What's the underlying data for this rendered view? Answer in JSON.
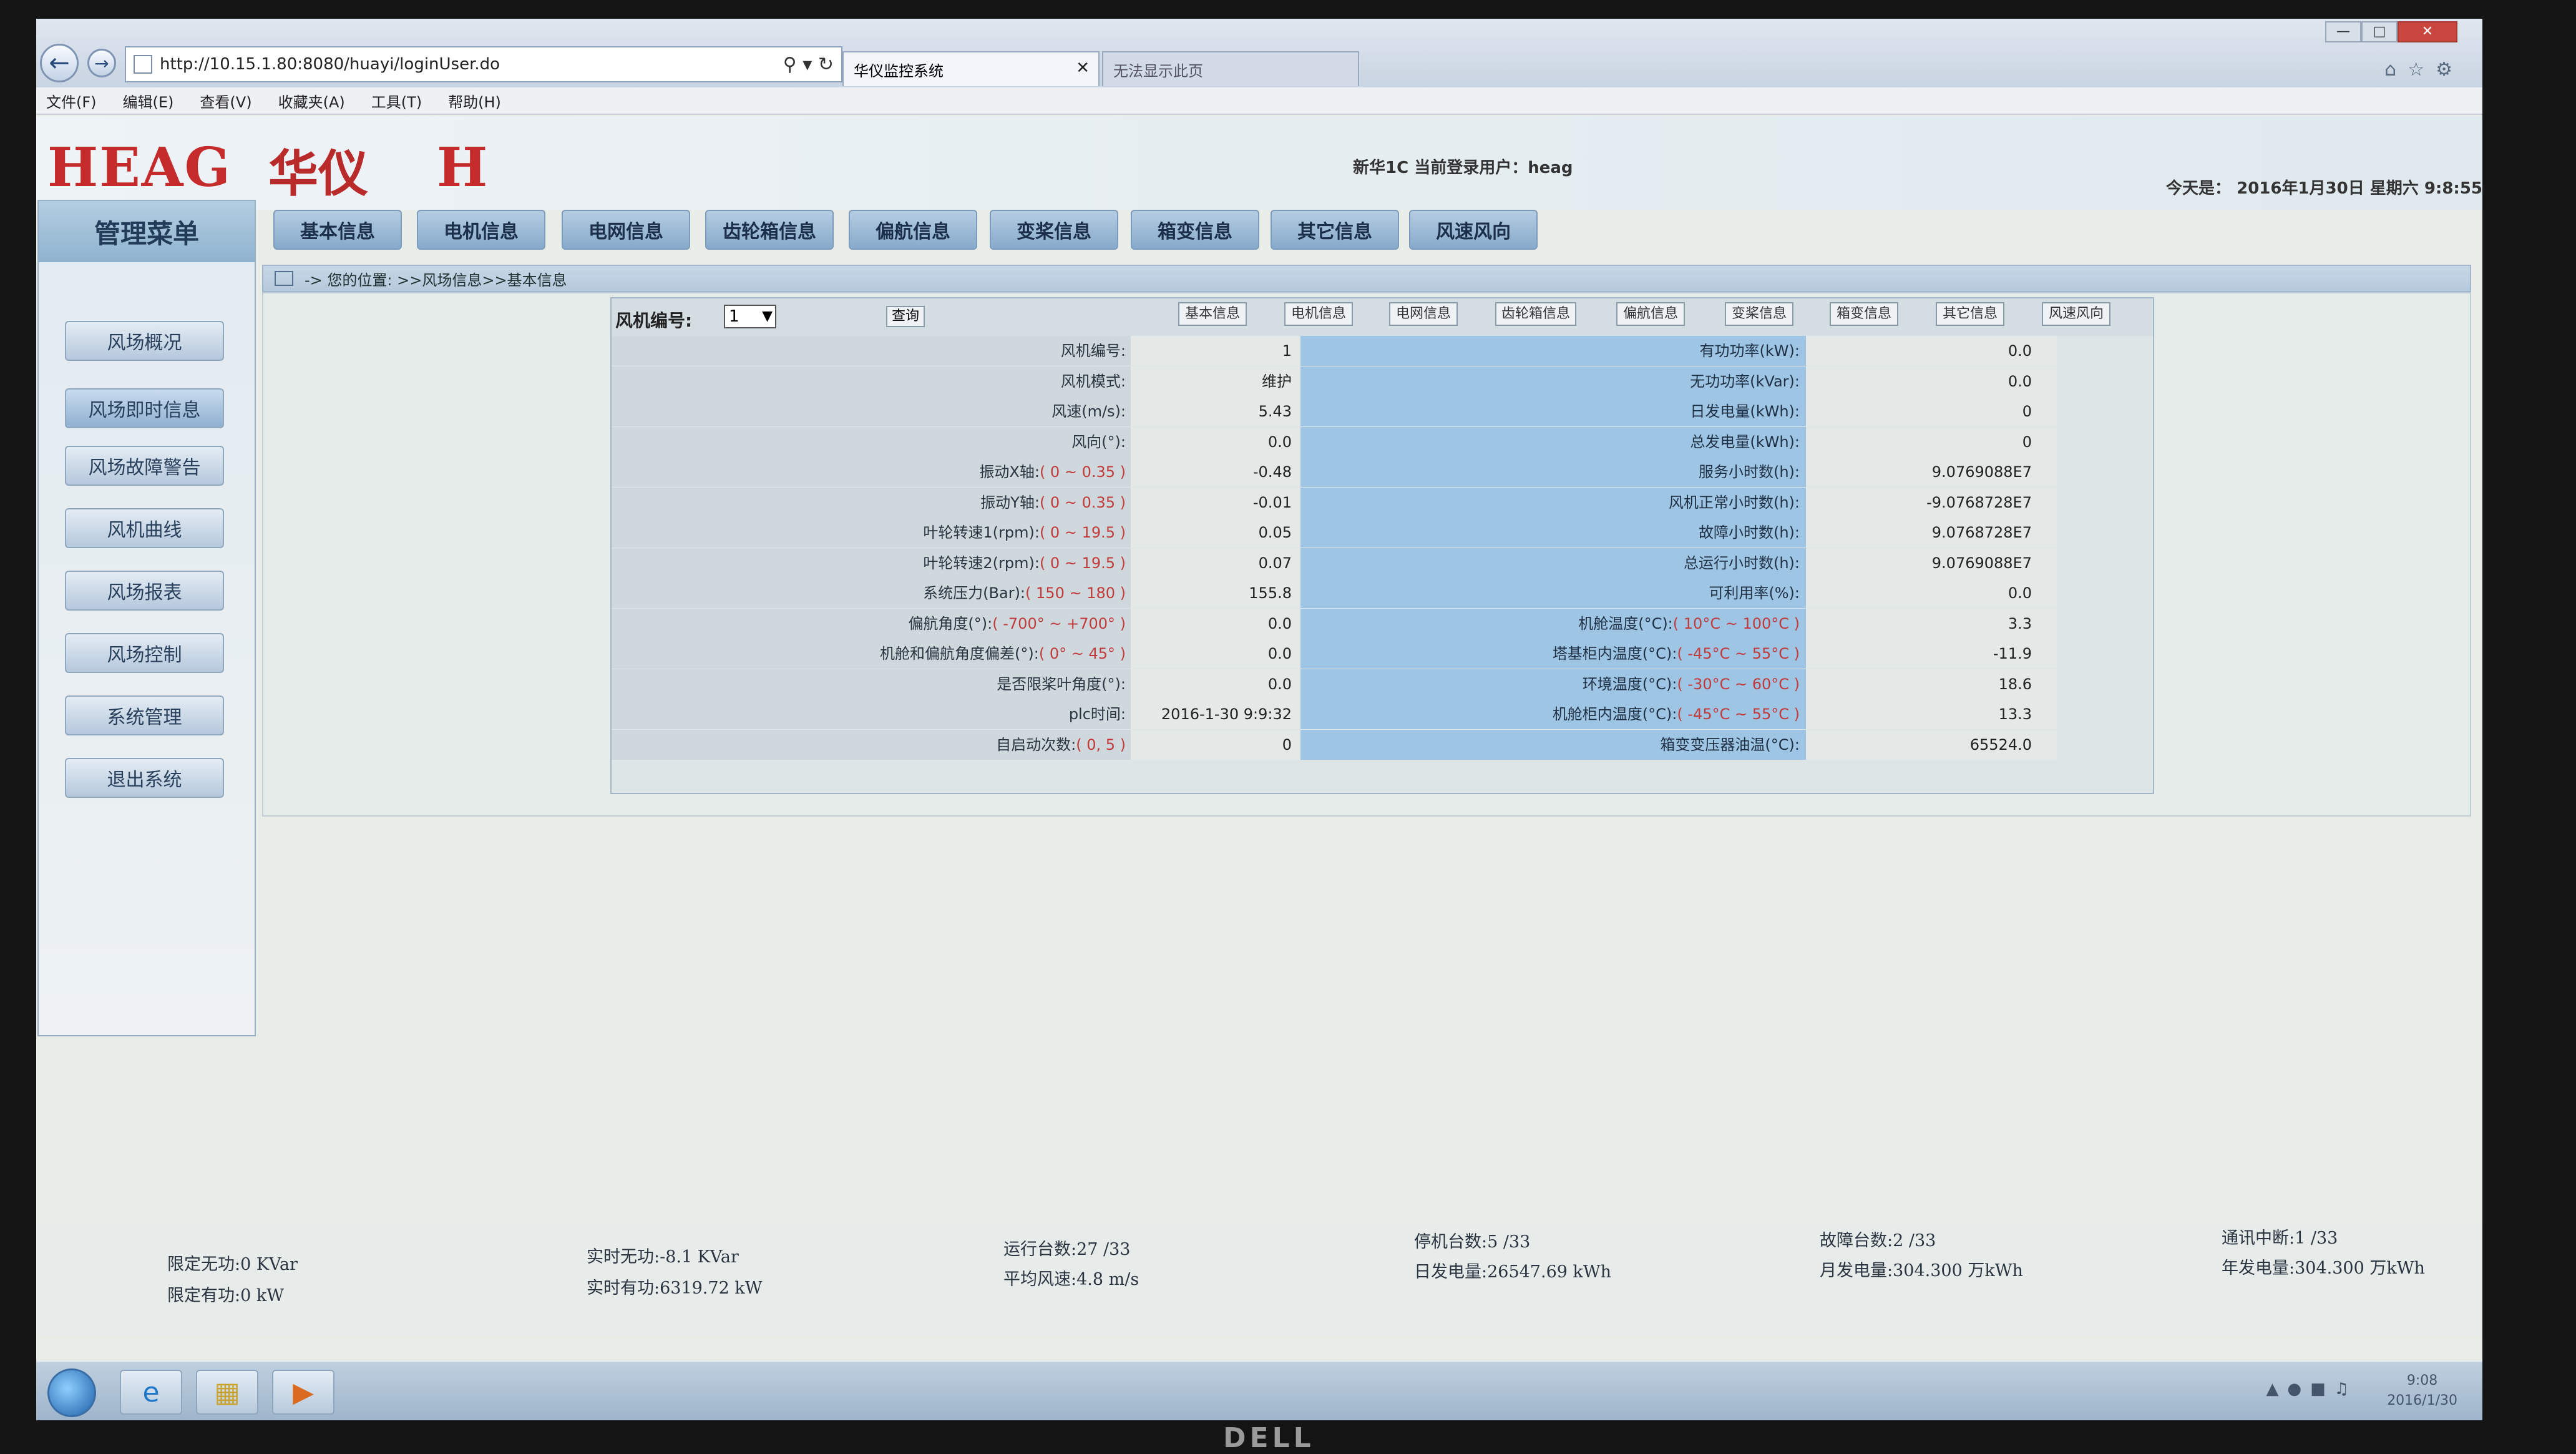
{
  "browser": {
    "url": "http://10.15.1.80:8080/huayi/loginUser.do",
    "tab_active": "华仪监控系统",
    "tab_inactive": "无法显示此页",
    "menu": [
      "文件(F)",
      "编辑(E)",
      "查看(V)",
      "收藏夹(A)",
      "工具(T)",
      "帮助(H)"
    ]
  },
  "header": {
    "logo_left": "HEAG",
    "logo_cn": "华仪",
    "logo_right": "H",
    "user_info": "新华1C  当前登录用户：heag",
    "today": "今天是： 2016年1月30日  星期六  9:8:55"
  },
  "sidebar": {
    "title": "管理菜单",
    "items": [
      "风场概况",
      "风场即时信息",
      "风场故障警告",
      "风机曲线",
      "风场报表",
      "风场控制",
      "系统管理",
      "退出系统"
    ]
  },
  "top_tabs": [
    "基本信息",
    "电机信息",
    "电网信息",
    "齿轮箱信息",
    "偏航信息",
    "变桨信息",
    "箱变信息",
    "其它信息",
    "风速风向"
  ],
  "breadcrumb": "-> 您的位置: >>风场信息>>基本信息",
  "panel": {
    "fan_no_label": "风机编号:",
    "fan_no_value": "1",
    "query_label": "查询",
    "sub_tabs": [
      "基本信息",
      "电机信息",
      "电网信息",
      "齿轮箱信息",
      "偏航信息",
      "变桨信息",
      "箱变信息",
      "其它信息",
      "风速风向"
    ],
    "left_rows": [
      {
        "label": "风机编号:",
        "range": "",
        "value": "1"
      },
      {
        "label": "风机模式:",
        "range": "",
        "value": "维护"
      },
      {
        "label": "风速(m/s):",
        "range": "",
        "value": "5.43"
      },
      {
        "label": "风向(°):",
        "range": "",
        "value": "0.0"
      },
      {
        "label": "振动X轴:",
        "range": "( 0 ~ 0.35 )",
        "value": "-0.48"
      },
      {
        "label": "振动Y轴:",
        "range": "( 0 ~ 0.35 )",
        "value": "-0.01"
      },
      {
        "label": "叶轮转速1(rpm):",
        "range": "( 0 ~ 19.5 )",
        "value": "0.05"
      },
      {
        "label": "叶轮转速2(rpm):",
        "range": "( 0 ~ 19.5 )",
        "value": "0.07"
      },
      {
        "label": "系统压力(Bar):",
        "range": "( 150 ~ 180 )",
        "value": "155.8"
      },
      {
        "label": "偏航角度(°):",
        "range": "( -700° ~ +700° )",
        "value": "0.0"
      },
      {
        "label": "机舱和偏航角度偏差(°):",
        "range": "( 0° ~ 45° )",
        "value": "0.0"
      },
      {
        "label": "是否限桨叶角度(°):",
        "range": "",
        "value": "0.0"
      },
      {
        "label": "plc时间:",
        "range": "",
        "value": "2016-1-30 9:9:32"
      },
      {
        "label": "自启动次数:",
        "range": "( 0, 5 )",
        "value": "0"
      }
    ],
    "right_rows": [
      {
        "label": "有功功率(kW):",
        "range": "",
        "value": "0.0"
      },
      {
        "label": "无功功率(kVar):",
        "range": "",
        "value": "0.0"
      },
      {
        "label": "日发电量(kWh):",
        "range": "",
        "value": "0"
      },
      {
        "label": "总发电量(kWh):",
        "range": "",
        "value": "0"
      },
      {
        "label": "服务小时数(h):",
        "range": "",
        "value": "9.0769088E7"
      },
      {
        "label": "风机正常小时数(h):",
        "range": "",
        "value": "-9.0768728E7"
      },
      {
        "label": "故障小时数(h):",
        "range": "",
        "value": "9.0768728E7"
      },
      {
        "label": "总运行小时数(h):",
        "range": "",
        "value": "9.0769088E7"
      },
      {
        "label": "可利用率(%):",
        "range": "",
        "value": "0.0"
      },
      {
        "label": "机舱温度(°C):",
        "range": "( 10°C ~ 100°C )",
        "value": "3.3"
      },
      {
        "label": "塔基柜内温度(°C):",
        "range": "( -45°C ~ 55°C )",
        "value": "-11.9"
      },
      {
        "label": "环境温度(°C):",
        "range": "( -30°C ~ 60°C )",
        "value": "18.6"
      },
      {
        "label": "机舱柜内温度(°C):",
        "range": "( -45°C ~ 55°C )",
        "value": "13.3"
      },
      {
        "label": "箱变变压器油温(°C):",
        "range": "",
        "value": "65524.0"
      }
    ]
  },
  "status": {
    "reactive_limit": "限定无功:0 KVar",
    "active_limit": "限定有功:0 kW",
    "realtime_reactive": "实时无功:-8.1 KVar",
    "realtime_active": "实时有功:6319.72 kW",
    "running": "运行台数:27 /33",
    "avg_wind": "平均风速:4.8 m/s",
    "stopped": "停机台数:5 /33",
    "daily_energy": "日发电量:26547.69 kWh",
    "faults": "故障台数:2 /33",
    "monthly_energy": "月发电量:304.300 万kWh",
    "comm_break": "通讯中断:1 /33",
    "yearly_energy": "年发电量:304.300 万kWh"
  },
  "taskbar": {
    "time": "9:08",
    "date": "2016/1/30"
  },
  "monitor_brand": "DELL"
}
